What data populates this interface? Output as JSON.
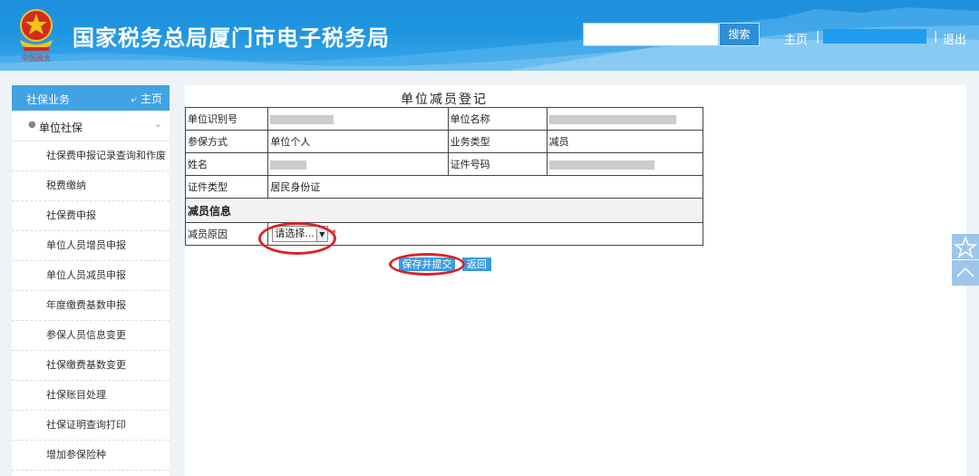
{
  "header": {
    "site_title": "国家税务总局厦门市电子税务局",
    "search_button": "搜索",
    "search_placeholder": "",
    "home_link": "主页",
    "separator": "|",
    "logout_link": "退出"
  },
  "sidebar": {
    "header_title": "社保业务",
    "header_home": "主页",
    "group_label": "单位社保",
    "items": [
      "社保费申报记录查询和作废",
      "税费缴纳",
      "社保费申报",
      "单位人员增员申报",
      "单位人员减员申报",
      "年度缴费基数申报",
      "参保人员信息变更",
      "社保缴费基数变更",
      "社保账目处理",
      "社保证明查询打印",
      "增加参保险种"
    ]
  },
  "form": {
    "title": "单位减员登记",
    "rows": [
      {
        "label1": "单位识别号",
        "value1": "",
        "label2": "单位名称",
        "value2": ""
      },
      {
        "label1": "参保方式",
        "value1": "单位个人",
        "label2": "业务类型",
        "value2": "减员"
      },
      {
        "label1": "姓名",
        "value1": "",
        "label2": "证件号码",
        "value2": ""
      }
    ],
    "cert_type_label": "证件类型",
    "cert_type_value": "居民身份证",
    "section_title": "减员信息",
    "reason_label": "减员原因",
    "reason_select": "请选择...",
    "required_mark": "*",
    "submit_button": "保存并提交",
    "back_button": "返回"
  },
  "colors": {
    "header_blue": "#1f95e0",
    "sidebar_header": "#41a2e4",
    "button_blue": "#3b9be0",
    "highlight_red": "#d7232a"
  }
}
